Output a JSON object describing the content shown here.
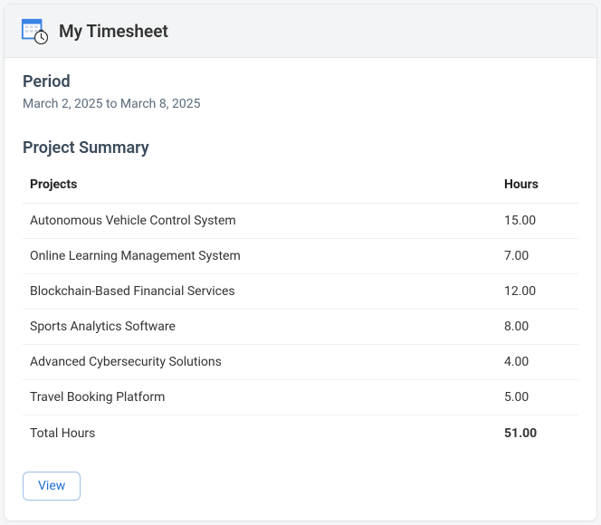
{
  "header": {
    "title": "My Timesheet"
  },
  "period": {
    "label": "Period",
    "value": "March 2, 2025 to March 8, 2025"
  },
  "summary": {
    "title": "Project Summary",
    "columns": {
      "projects": "Projects",
      "hours": "Hours"
    },
    "rows": [
      {
        "project": "Autonomous Vehicle Control System",
        "hours": "15.00"
      },
      {
        "project": "Online Learning Management System",
        "hours": "7.00"
      },
      {
        "project": "Blockchain-Based Financial Services",
        "hours": "12.00"
      },
      {
        "project": "Sports Analytics Software",
        "hours": "8.00"
      },
      {
        "project": "Advanced Cybersecurity Solutions",
        "hours": "4.00"
      },
      {
        "project": "Travel Booking Platform",
        "hours": "5.00"
      }
    ],
    "total": {
      "label": "Total Hours",
      "hours": "51.00"
    }
  },
  "actions": {
    "view": "View"
  },
  "icons": {
    "timesheet": "timesheet-calendar-clock-icon"
  },
  "colors": {
    "accent": "#1f6fd6"
  }
}
